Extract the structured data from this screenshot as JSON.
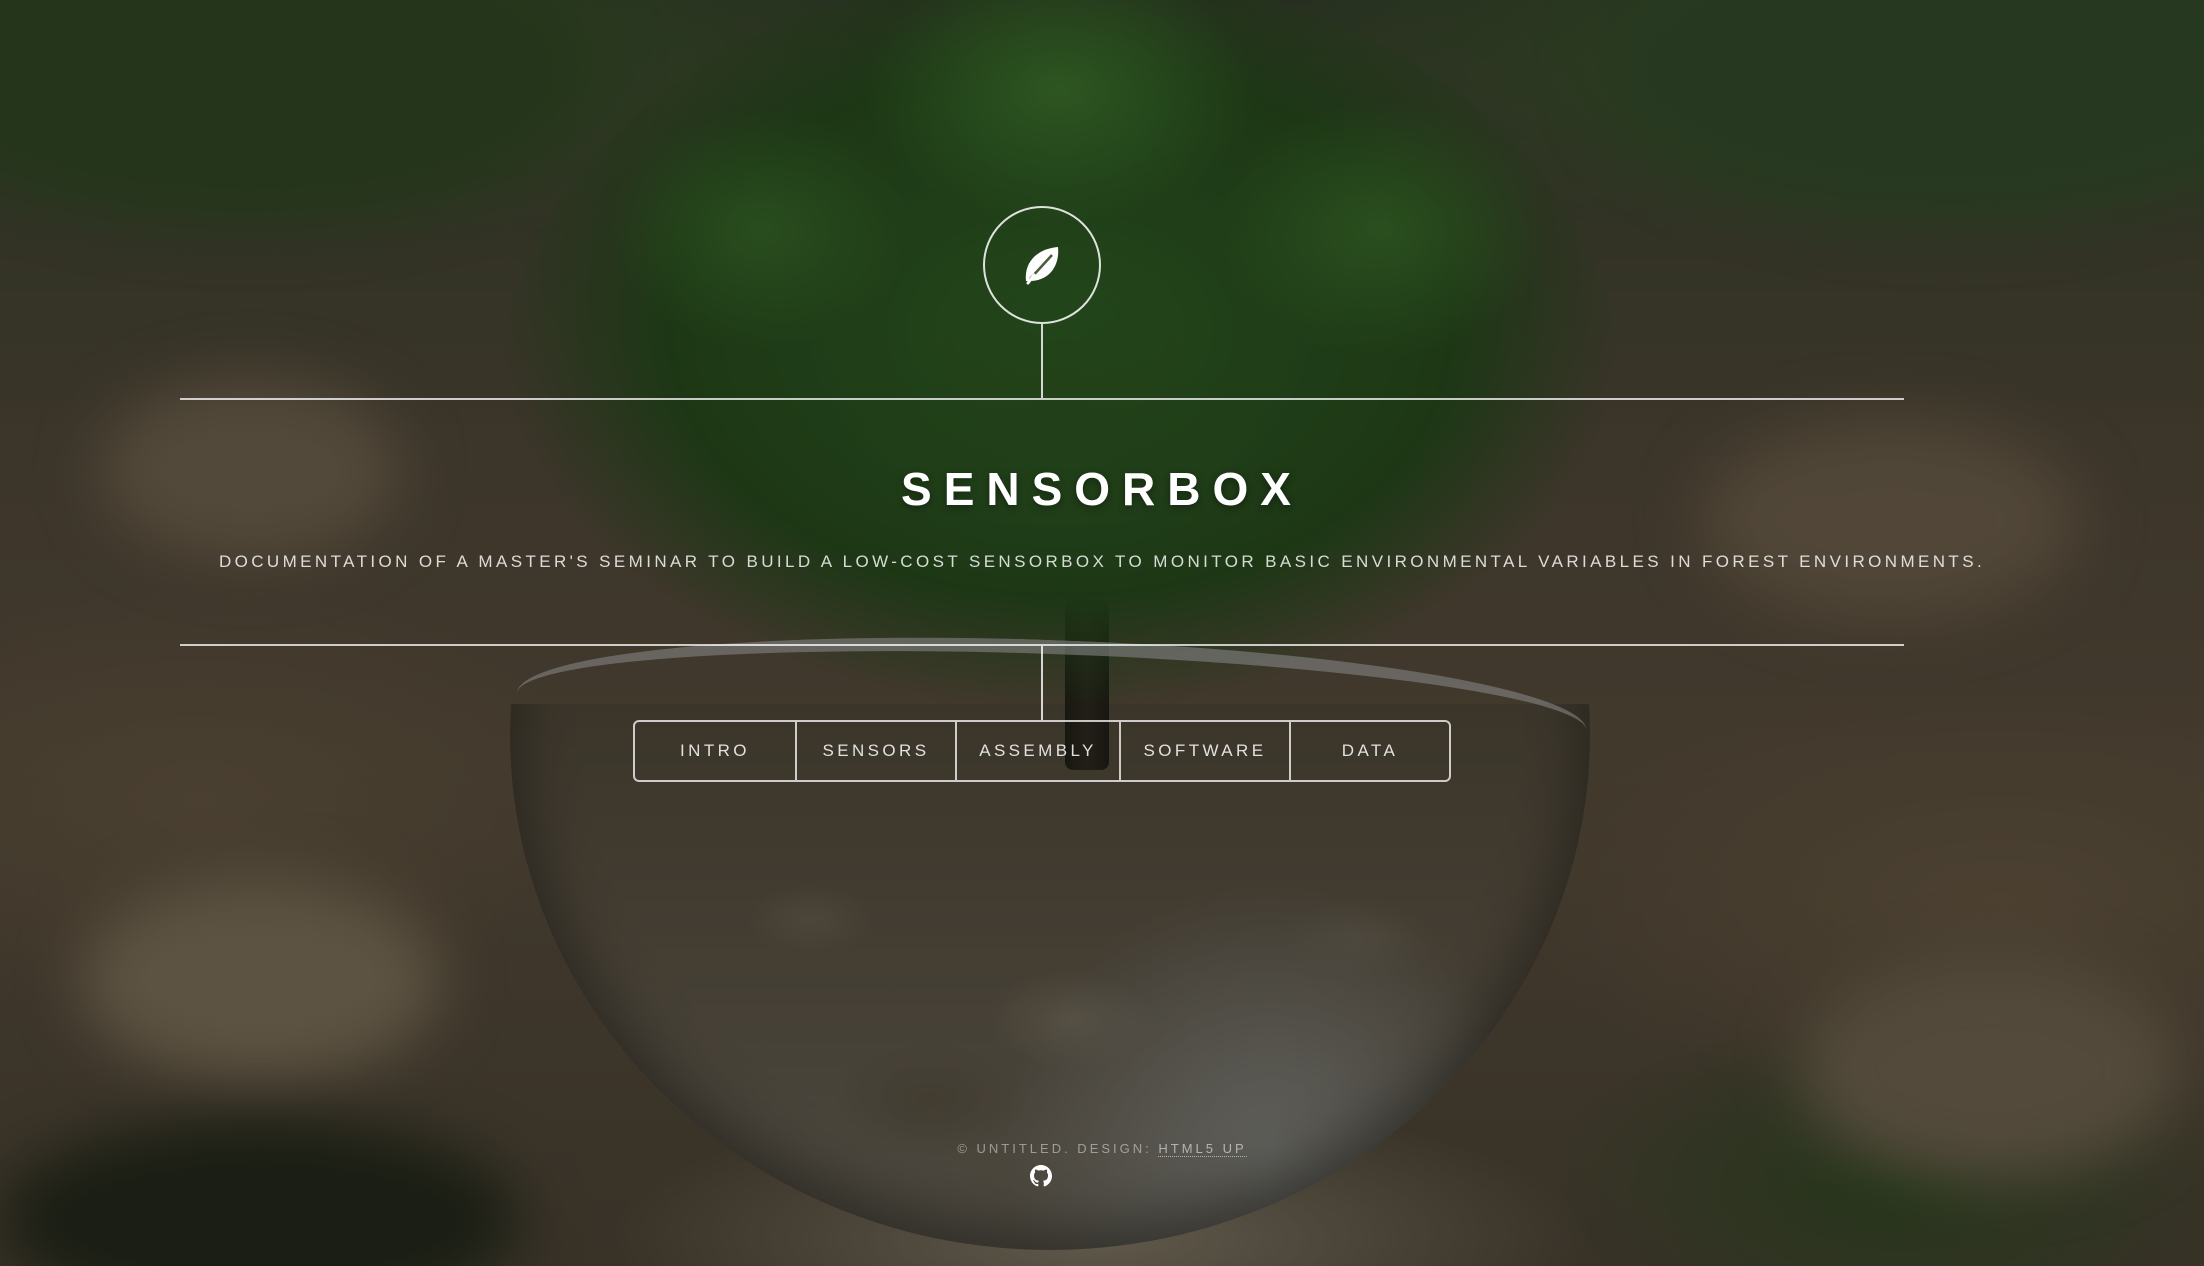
{
  "header": {
    "logo_icon": "leaf-icon",
    "title": "SENSORBOX",
    "subtitle": "Documentation of a Master's seminar to build a low-cost sensorbox to monitor basic environmental variables in forest environments."
  },
  "nav": {
    "items": [
      {
        "label": "Intro"
      },
      {
        "label": "Sensors"
      },
      {
        "label": "Assembly"
      },
      {
        "label": "Software"
      },
      {
        "label": "Data"
      }
    ]
  },
  "footer": {
    "copyright": "© Untitled. Design: ",
    "design_link": "HTML5 UP",
    "github_icon": "github-icon"
  }
}
